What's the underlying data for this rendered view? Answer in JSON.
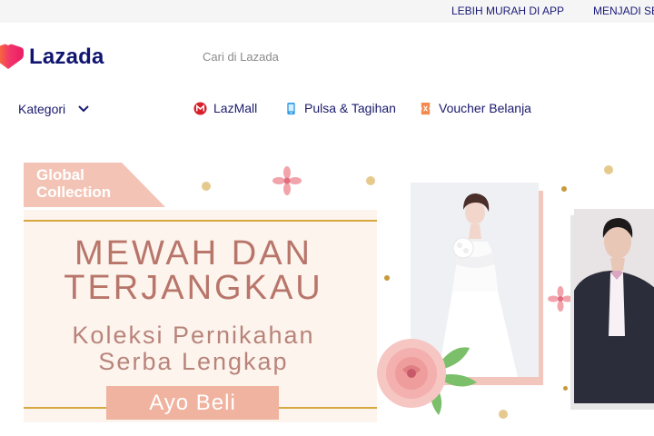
{
  "topbar": {
    "link1": "LEBIH MURAH DI APP",
    "link2": "MENJADI SE"
  },
  "header": {
    "logo_text": "Lazada",
    "search_placeholder": "Cari di Lazada",
    "brand_colors": {
      "pink": "#f2346b",
      "orange": "#f78a1e",
      "navy": "#10156f"
    }
  },
  "nav": {
    "kategori_label": "Kategori",
    "links": [
      {
        "label": "LazMall",
        "icon": "lazmall-icon"
      },
      {
        "label": "Pulsa & Tagihan",
        "icon": "phone-icon"
      },
      {
        "label": "Voucher Belanja",
        "icon": "voucher-icon"
      }
    ]
  },
  "banner": {
    "tag": "Global\nCollection",
    "headline": "MEWAH DAN\nTERJANGKAU",
    "subline": "Koleksi Pernikahan\nSerba Lengkap",
    "cta": "Ayo Beli",
    "colors": {
      "accent": "#f0b3a0",
      "headline": "#b8766a",
      "gold": "#d8a840"
    }
  }
}
